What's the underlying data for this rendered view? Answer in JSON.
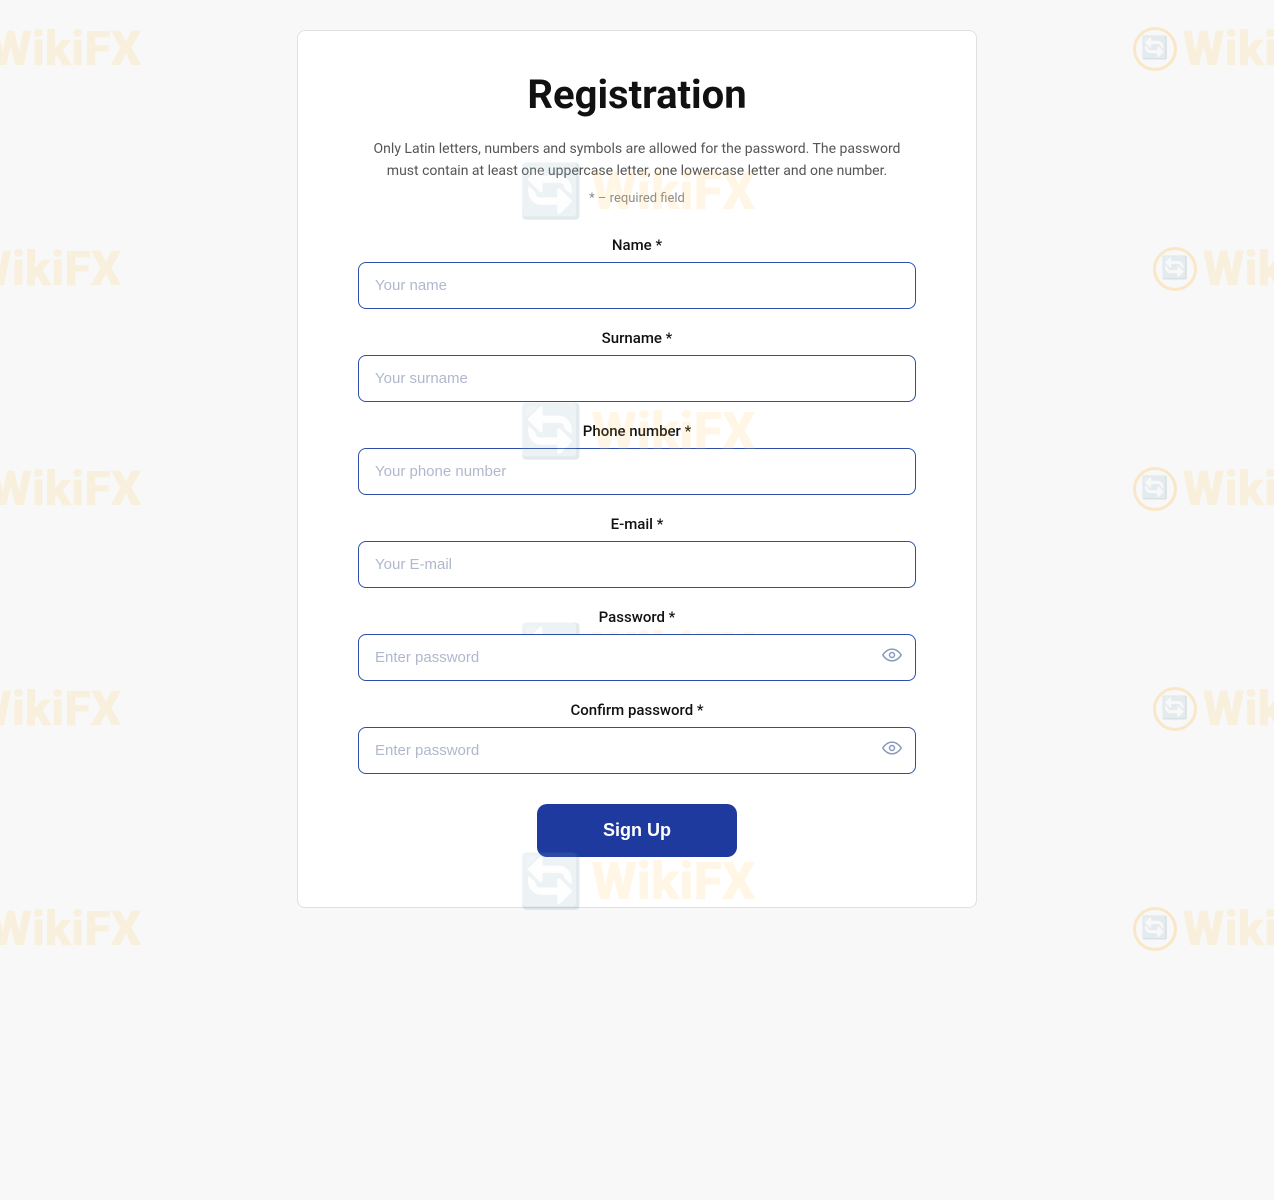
{
  "page": {
    "title": "Registration",
    "description": "Only Latin letters, numbers and symbols are allowed for the password. The password must contain at least one uppercase letter, one lowercase letter and one number.",
    "required_note": "* – required field"
  },
  "form": {
    "name": {
      "label": "Name *",
      "placeholder": "Your name"
    },
    "surname": {
      "label": "Surname *",
      "placeholder": "Your surname"
    },
    "phone": {
      "label": "Phone number *",
      "placeholder": "Your phone number"
    },
    "email": {
      "label": "E-mail *",
      "placeholder": "Your E-mail"
    },
    "password": {
      "label": "Password *",
      "placeholder": "Enter password"
    },
    "confirm_password": {
      "label": "Confirm password *",
      "placeholder": "Enter password"
    },
    "submit": "Sign Up"
  },
  "watermark": {
    "text": "WikiFX"
  }
}
